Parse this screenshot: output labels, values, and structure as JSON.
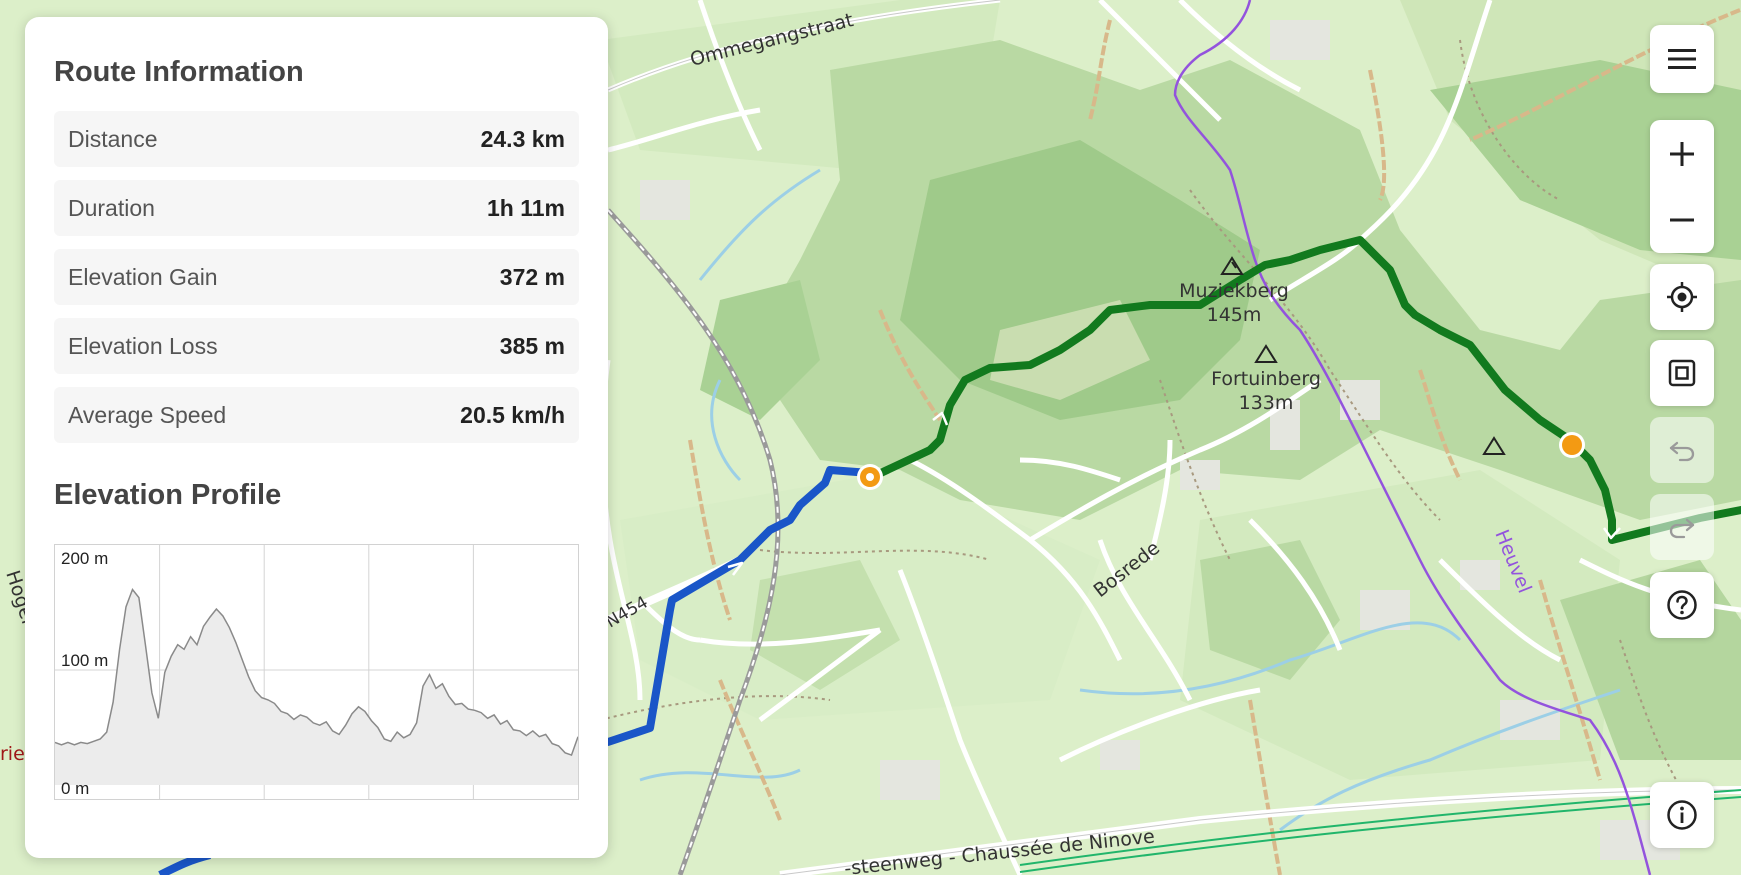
{
  "map": {
    "street_labels": {
      "ommegangstraat": "Ommegangstraat",
      "bosrede": "Bosrede",
      "heuvel": "Heuvel",
      "chaussee": "-steenweg - Chaussée de Ninove",
      "n454": "N454",
      "hoger": "Hoger",
      "lieu": "rieu"
    },
    "peaks": [
      {
        "name": "Muziekberg",
        "elevation": "145m"
      },
      {
        "name": "Fortuinberg",
        "elevation": "133m"
      }
    ],
    "colors": {
      "route_done": "#1a56c8",
      "route_ahead": "#127a1e",
      "marker": "#f39a13",
      "forest": "#b8d9a3",
      "forest_dark": "#9cc888",
      "meadow": "#d6ecc4",
      "trail": "#9353dd",
      "rail_green": "#21b56b"
    }
  },
  "panel": {
    "title": "Route Information",
    "stats": [
      {
        "label": "Distance",
        "value": "24.3 km"
      },
      {
        "label": "Duration",
        "value": "1h 11m"
      },
      {
        "label": "Elevation Gain",
        "value": "372 m"
      },
      {
        "label": "Elevation Loss",
        "value": "385 m"
      },
      {
        "label": "Average Speed",
        "value": "20.5 km/h"
      }
    ],
    "elevation_title": "Elevation Profile"
  },
  "chart_data": {
    "type": "area",
    "title": "Elevation Profile",
    "y_ticks": [
      "200 m",
      "100 m",
      "0 m"
    ],
    "ylim": [
      0,
      200
    ],
    "xlim": [
      0,
      24.3
    ],
    "grid": true,
    "x": [
      0,
      0.3,
      0.6,
      0.9,
      1.2,
      1.5,
      1.8,
      2.1,
      2.4,
      2.7,
      3.0,
      3.3,
      3.6,
      3.9,
      4.2,
      4.5,
      4.8,
      5.1,
      5.4,
      5.7,
      6.0,
      6.3,
      6.6,
      6.9,
      7.2,
      7.5,
      7.8,
      8.1,
      8.4,
      8.7,
      9.0,
      9.3,
      9.6,
      9.9,
      10.2,
      10.5,
      10.8,
      11.1,
      11.4,
      11.7,
      12.0,
      12.3,
      12.6,
      12.9,
      13.2,
      13.5,
      13.8,
      14.1,
      14.4,
      14.7,
      15.0,
      15.3,
      15.6,
      15.9,
      16.2,
      16.5,
      16.8,
      17.1,
      17.4,
      17.7,
      18.0,
      18.3,
      18.6,
      18.9,
      19.2,
      19.5,
      19.8,
      20.1,
      20.4,
      20.7,
      21.0,
      21.3,
      21.6,
      21.9,
      22.2,
      22.5,
      22.8,
      23.1,
      23.4,
      23.7,
      24.0,
      24.3
    ],
    "series": [
      {
        "values": [
          37,
          35,
          37,
          35,
          37,
          36,
          38,
          40,
          46,
          72,
          118,
          155,
          170,
          163,
          122,
          80,
          58,
          98,
          112,
          122,
          118,
          129,
          122,
          138,
          146,
          153,
          147,
          137,
          124,
          109,
          94,
          82,
          76,
          74,
          71,
          64,
          62,
          57,
          61,
          59,
          54,
          52,
          55,
          47,
          44,
          52,
          62,
          68,
          64,
          56,
          50,
          40,
          38,
          46,
          41,
          44,
          54,
          86,
          96,
          84,
          88,
          77,
          70,
          71,
          66,
          65,
          63,
          58,
          61,
          53,
          56,
          48,
          47,
          43,
          47,
          42,
          44,
          36,
          34,
          28,
          26,
          42
        ]
      }
    ]
  }
}
